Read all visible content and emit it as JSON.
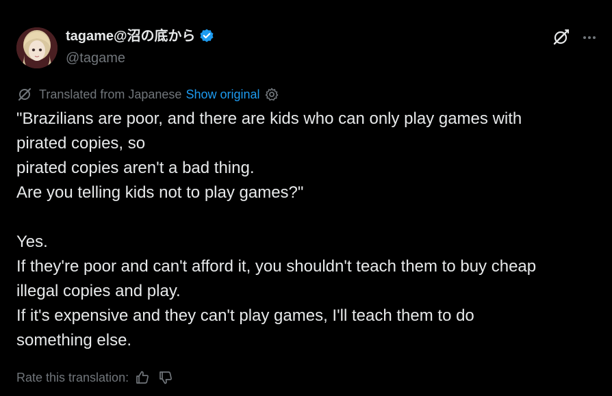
{
  "post": {
    "author": {
      "display_name": "tagame@沼の底から",
      "handle": "@tagame",
      "verified": true
    },
    "translation": {
      "label": "Translated from Japanese",
      "show_original": "Show original"
    },
    "text_lines": [
      "\"Brazilians are poor, and there are kids who can only play games with",
      "pirated copies, so",
      "pirated copies aren't a bad thing.",
      "Are you telling kids not to play games?\"",
      "",
      "Yes.",
      "If they're poor and can't afford it, you shouldn't teach them to buy cheap",
      "illegal copies and play.",
      "If it's expensive and they can't play games, I'll teach them to do",
      "something else."
    ],
    "rate": {
      "label": "Rate this translation:"
    },
    "icons": {
      "verified": "verified-badge-icon",
      "grok": "grok-icon",
      "more": "more-icon",
      "translate": "translate-icon",
      "settings": "settings-gear-icon",
      "thumbs_up": "thumbs-up-icon",
      "thumbs_down": "thumbs-down-icon"
    },
    "colors": {
      "background": "#000000",
      "text": "#e7e9ea",
      "secondary": "#71767b",
      "link": "#1d9bf0",
      "verified": "#1d9bf0"
    }
  }
}
